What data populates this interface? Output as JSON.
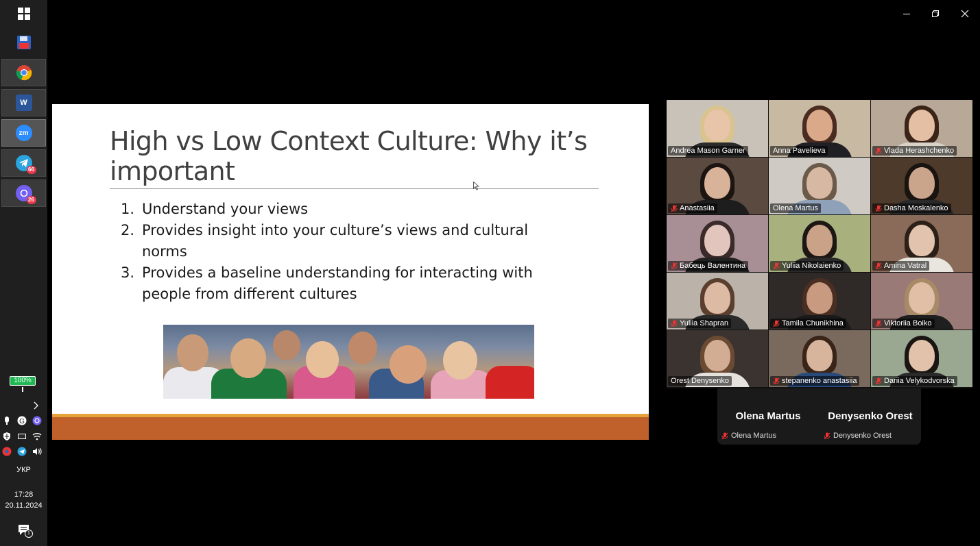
{
  "taskbar": {
    "apps": [
      {
        "name": "start-button",
        "icon": "windows-icon"
      },
      {
        "name": "save-app",
        "icon": "floppy-icon"
      },
      {
        "name": "chrome-app",
        "icon": "chrome-icon"
      },
      {
        "name": "word-app",
        "icon": "word-icon",
        "label": "W"
      },
      {
        "name": "zoom-app",
        "icon": "zoom-icon",
        "label": "zm"
      },
      {
        "name": "telegram-app",
        "icon": "telegram-icon",
        "badge": "66"
      },
      {
        "name": "viber-app",
        "icon": "viber-icon",
        "badge": "26"
      }
    ],
    "battery": "100%",
    "language": "УКР",
    "time": "17:28",
    "date": "20.11.2024",
    "notification_count": "1",
    "tray_badges": {
      "record": "6",
      "telegram": "66"
    }
  },
  "slide": {
    "title": "High vs Low Context Culture: Why it’s important",
    "items": [
      {
        "num": "1.",
        "text": "Understand your views"
      },
      {
        "num": "2.",
        "text": "Provides insight into your culture’s views and cultural norms"
      },
      {
        "num": "3.",
        "text": "Provides a baseline understanding for interacting with people from different cultures"
      }
    ],
    "photo_alt": "group-of-students-photo",
    "colors": {
      "band": "#c0612b",
      "gold": "#e6a33a"
    }
  },
  "participants": [
    {
      "name": "Andrea Mason Garner",
      "muted": false,
      "speaking": true,
      "bg": "#c9c2b8",
      "skin": "#e8c4a8",
      "hair": "#d9c38f",
      "shirt": "#2b2b2b"
    },
    {
      "name": "Anna Pavelieva",
      "muted": false,
      "speaking": false,
      "bg": "#c8b9a3",
      "skin": "#d9a98a",
      "hair": "#4a2b1f",
      "shirt": "#1f1f24"
    },
    {
      "name": "Vlada Herashchenko",
      "muted": true,
      "speaking": false,
      "bg": "#b7a898",
      "skin": "#e4bfa3",
      "hair": "#3a2418",
      "shirt": "#d8d2c8"
    },
    {
      "name": "Anastasiia",
      "muted": true,
      "speaking": false,
      "bg": "#5a4a40",
      "skin": "#d9b29a",
      "hair": "#1c1410",
      "shirt": "#1d1d1d"
    },
    {
      "name": "Olena Martus",
      "muted": false,
      "speaking": false,
      "bg": "#cfcac4",
      "skin": "#d7b8a3",
      "hair": "#6b5a4a",
      "shirt": "#8ea1b8"
    },
    {
      "name": "Dasha Moskalenko",
      "muted": true,
      "speaking": false,
      "bg": "#4e3a2a",
      "skin": "#caa58c",
      "hair": "#1a1410",
      "shirt": "#2a2a2a"
    },
    {
      "name": "Бабець Валентина",
      "muted": true,
      "speaking": false,
      "bg": "#a88f96",
      "skin": "#e2c6bd",
      "hair": "#3a2a2a",
      "shirt": "#222222"
    },
    {
      "name": "Yuliia Nikolaienko",
      "muted": true,
      "speaking": false,
      "bg": "#a8b07e",
      "skin": "#caa288",
      "hair": "#1d1613",
      "shirt": "#2a2a2a"
    },
    {
      "name": "Amina Vatral",
      "muted": true,
      "speaking": false,
      "bg": "#8a6a58",
      "skin": "#e2c3ad",
      "hair": "#2b1f18",
      "shirt": "#e9e6e0"
    },
    {
      "name": "Yuliia Shapran",
      "muted": true,
      "speaking": false,
      "bg": "#bbb3aa",
      "skin": "#dcbaa4",
      "hair": "#5a3f2e",
      "shirt": "#2a2a2a"
    },
    {
      "name": "Tamila Chunikhina",
      "muted": true,
      "speaking": false,
      "bg": "#2f2a28",
      "skin": "#c89a80",
      "hair": "#4a2e22",
      "shirt": "#1a1a1a"
    },
    {
      "name": "Viktoriia Boiko",
      "muted": true,
      "speaking": false,
      "bg": "#9a7a76",
      "skin": "#e0bfa6",
      "hair": "#a88a66",
      "shirt": "#1f1f1f"
    },
    {
      "name": "Orest Denysenko",
      "muted": false,
      "speaking": false,
      "bg": "#3a3330",
      "skin": "#d2ad94",
      "hair": "#6b4a33",
      "shirt": "#e5e1dc"
    },
    {
      "name": "stepanenko anastasiia",
      "muted": true,
      "speaking": false,
      "bg": "#7a6a5e",
      "skin": "#d7b59c",
      "hair": "#3a2418",
      "shirt": "#2a4a7a"
    },
    {
      "name": "Dariia Velykodvorska",
      "muted": true,
      "speaking": false,
      "bg": "#9aa892",
      "skin": "#e2c2ab",
      "hair": "#1a1512",
      "shirt": "#2a2a2a"
    }
  ],
  "name_panel": [
    {
      "big": "Olena Martus",
      "small": "Olena Martus"
    },
    {
      "big": "Denysenko Orest",
      "small": "Denysenko Orest"
    }
  ],
  "window_controls": {
    "minimize": "minimize-icon",
    "restore": "restore-icon",
    "close": "close-icon"
  }
}
